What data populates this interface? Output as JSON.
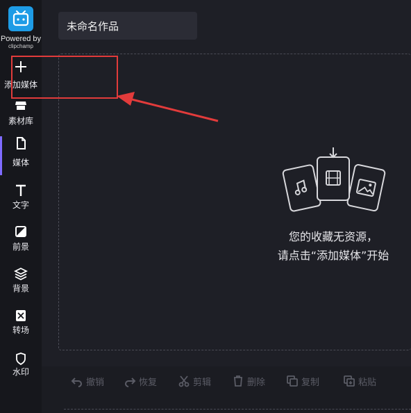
{
  "sidebar": {
    "powered_by": "Powered by",
    "powered_by_brand": "clipchamp",
    "items": [
      {
        "label": "添加媒体",
        "icon": "plus-icon"
      },
      {
        "label": "素材库",
        "icon": "store-icon"
      },
      {
        "label": "媒体",
        "icon": "file-icon"
      },
      {
        "label": "文字",
        "icon": "text-icon"
      },
      {
        "label": "前景",
        "icon": "foreground-icon"
      },
      {
        "label": "背景",
        "icon": "layers-icon"
      },
      {
        "label": "转场",
        "icon": "transition-icon"
      },
      {
        "label": "水印",
        "icon": "shield-icon"
      }
    ],
    "active_item": "媒体"
  },
  "header": {
    "project_title": "未命名作品"
  },
  "empty_state": {
    "line1": "您的收藏无资源，",
    "line2": "请点击“添加媒体”开始"
  },
  "toolbar": {
    "undo": "撤销",
    "redo": "恢复",
    "cut": "剪辑",
    "delete": "删除",
    "copy": "复制",
    "paste": "粘贴"
  },
  "colors": {
    "accent": "#7f6bff",
    "logo": "#1e9ce6",
    "annotation": "#e23b3b"
  }
}
